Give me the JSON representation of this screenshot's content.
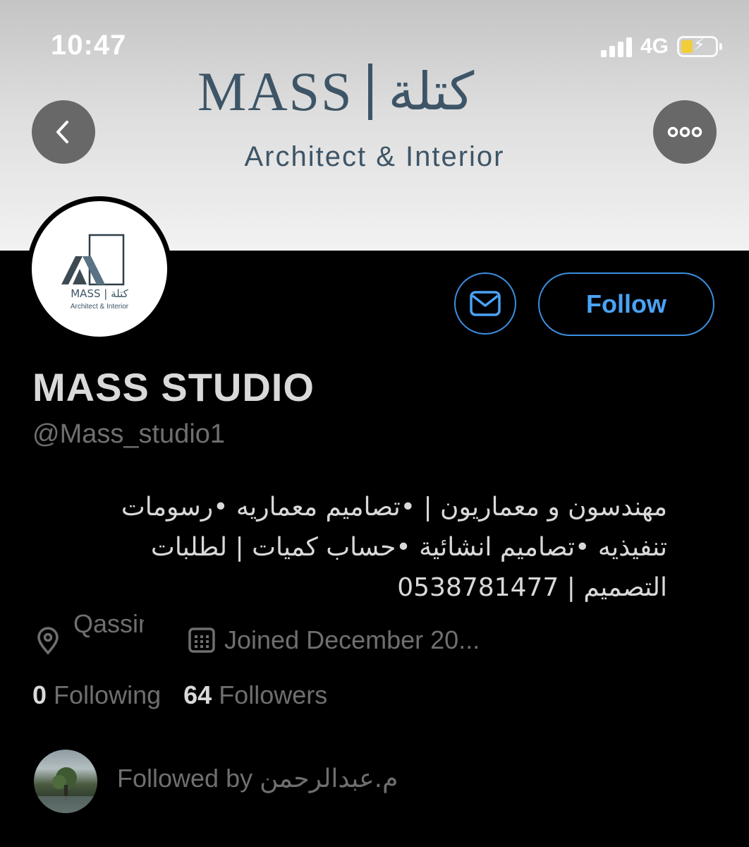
{
  "status_bar": {
    "time": "10:47",
    "network": "4G"
  },
  "banner": {
    "logo_latin": "MASS",
    "logo_arabic": "كتلة",
    "logo_subtitle": "Architect & Interior"
  },
  "avatar": {
    "logo_text": "MASS | كتلة",
    "logo_subtitle": "Architect & Interior"
  },
  "actions": {
    "follow_label": "Follow"
  },
  "profile": {
    "name": "MASS STUDIO",
    "handle": "@Mass_studio1",
    "bio_lines": [
      "مهندسون و معماريون | •تصاميم معماريه •رسومات",
      "تنفيذيه •تصاميم انشائية •حساب كميات | لطلبات",
      "التصميم | 0538781477"
    ],
    "location": "Qassim",
    "joined": "Joined December 20..."
  },
  "counts": {
    "following_count": "0",
    "following_label": "Following",
    "followers_count": "64",
    "followers_label": "Followers"
  },
  "followed_by": {
    "prefix": "Followed by",
    "name": "م.عبدالرحمن"
  },
  "icons": {
    "back": "chevron-left-icon",
    "more": "more-horizontal-icon",
    "mail": "envelope-icon",
    "location": "location-pin-icon",
    "calendar": "calendar-icon"
  },
  "colors": {
    "accent": "#4aa3f5",
    "logo": "#3d5566",
    "secondary_text": "#6f6f6f",
    "battery": "#f5cd2a"
  }
}
